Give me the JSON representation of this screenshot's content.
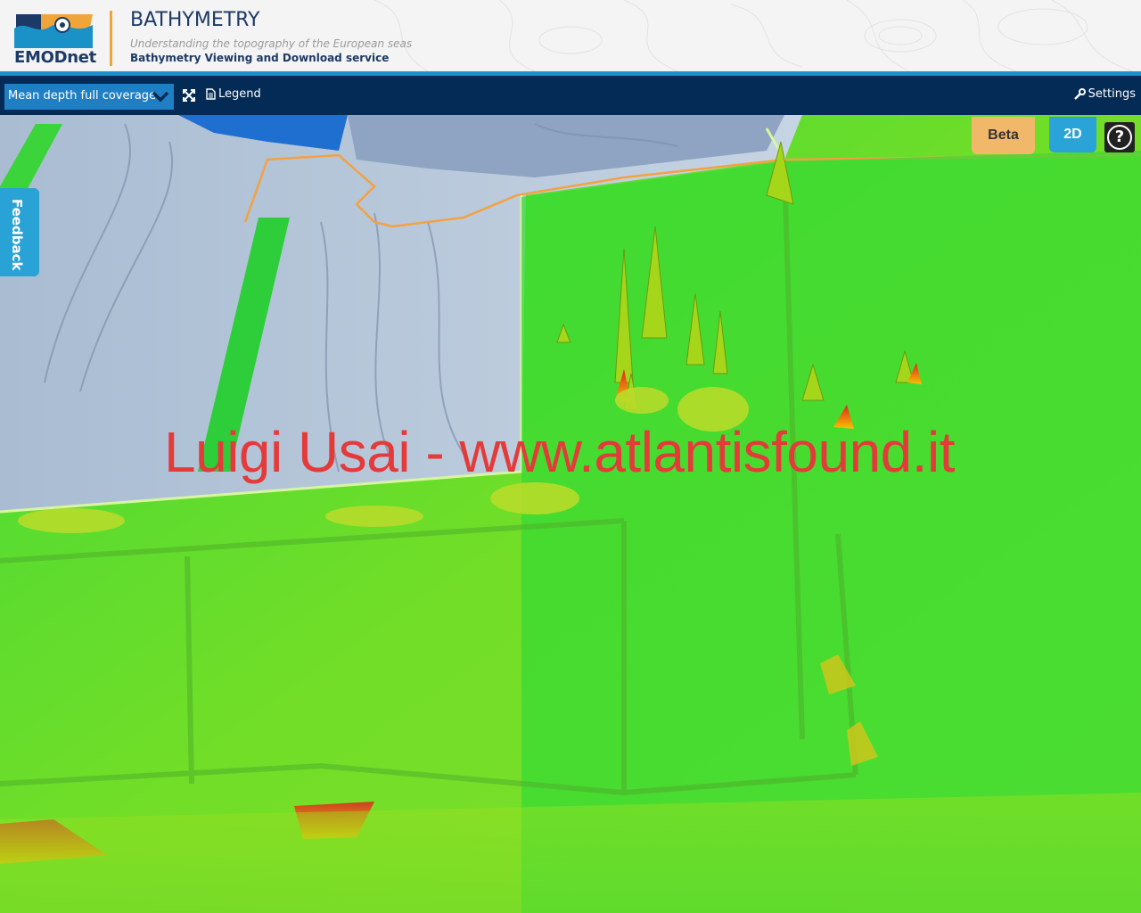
{
  "header": {
    "logo_text": "EMODnet",
    "title": "BATHYMETRY",
    "subtitle": "Understanding the topography of the European seas",
    "service": "Bathymetry Viewing and Download service"
  },
  "toolbar": {
    "layer_select_value": "Mean depth full coverage",
    "legend_label": "Legend",
    "settings_label": "Settings"
  },
  "map": {
    "beta_label": "Beta",
    "view_mode_label": "2D",
    "help_label": "?",
    "feedback_label": "Feedback",
    "watermark": "Luigi Usai - www.atlantisfound.it"
  },
  "colors": {
    "header_bg": "#f4f4f4",
    "toolbar_bg": "#032b56",
    "accent_blue": "#1b92c7",
    "logo_orange": "#f0a53a",
    "select_bg": "#1e7fc4",
    "beta_bg": "#f2b86a",
    "mode_bg": "#2aa3d9",
    "terrain_green": "#6fd92c",
    "terrain_grey_blue": "#b9c9da",
    "watermark_red": "#e43a3a"
  },
  "icons": [
    "wave-logo-icon",
    "chevron-down-icon",
    "expand-icon",
    "document-icon",
    "wrench-icon",
    "question-icon"
  ]
}
